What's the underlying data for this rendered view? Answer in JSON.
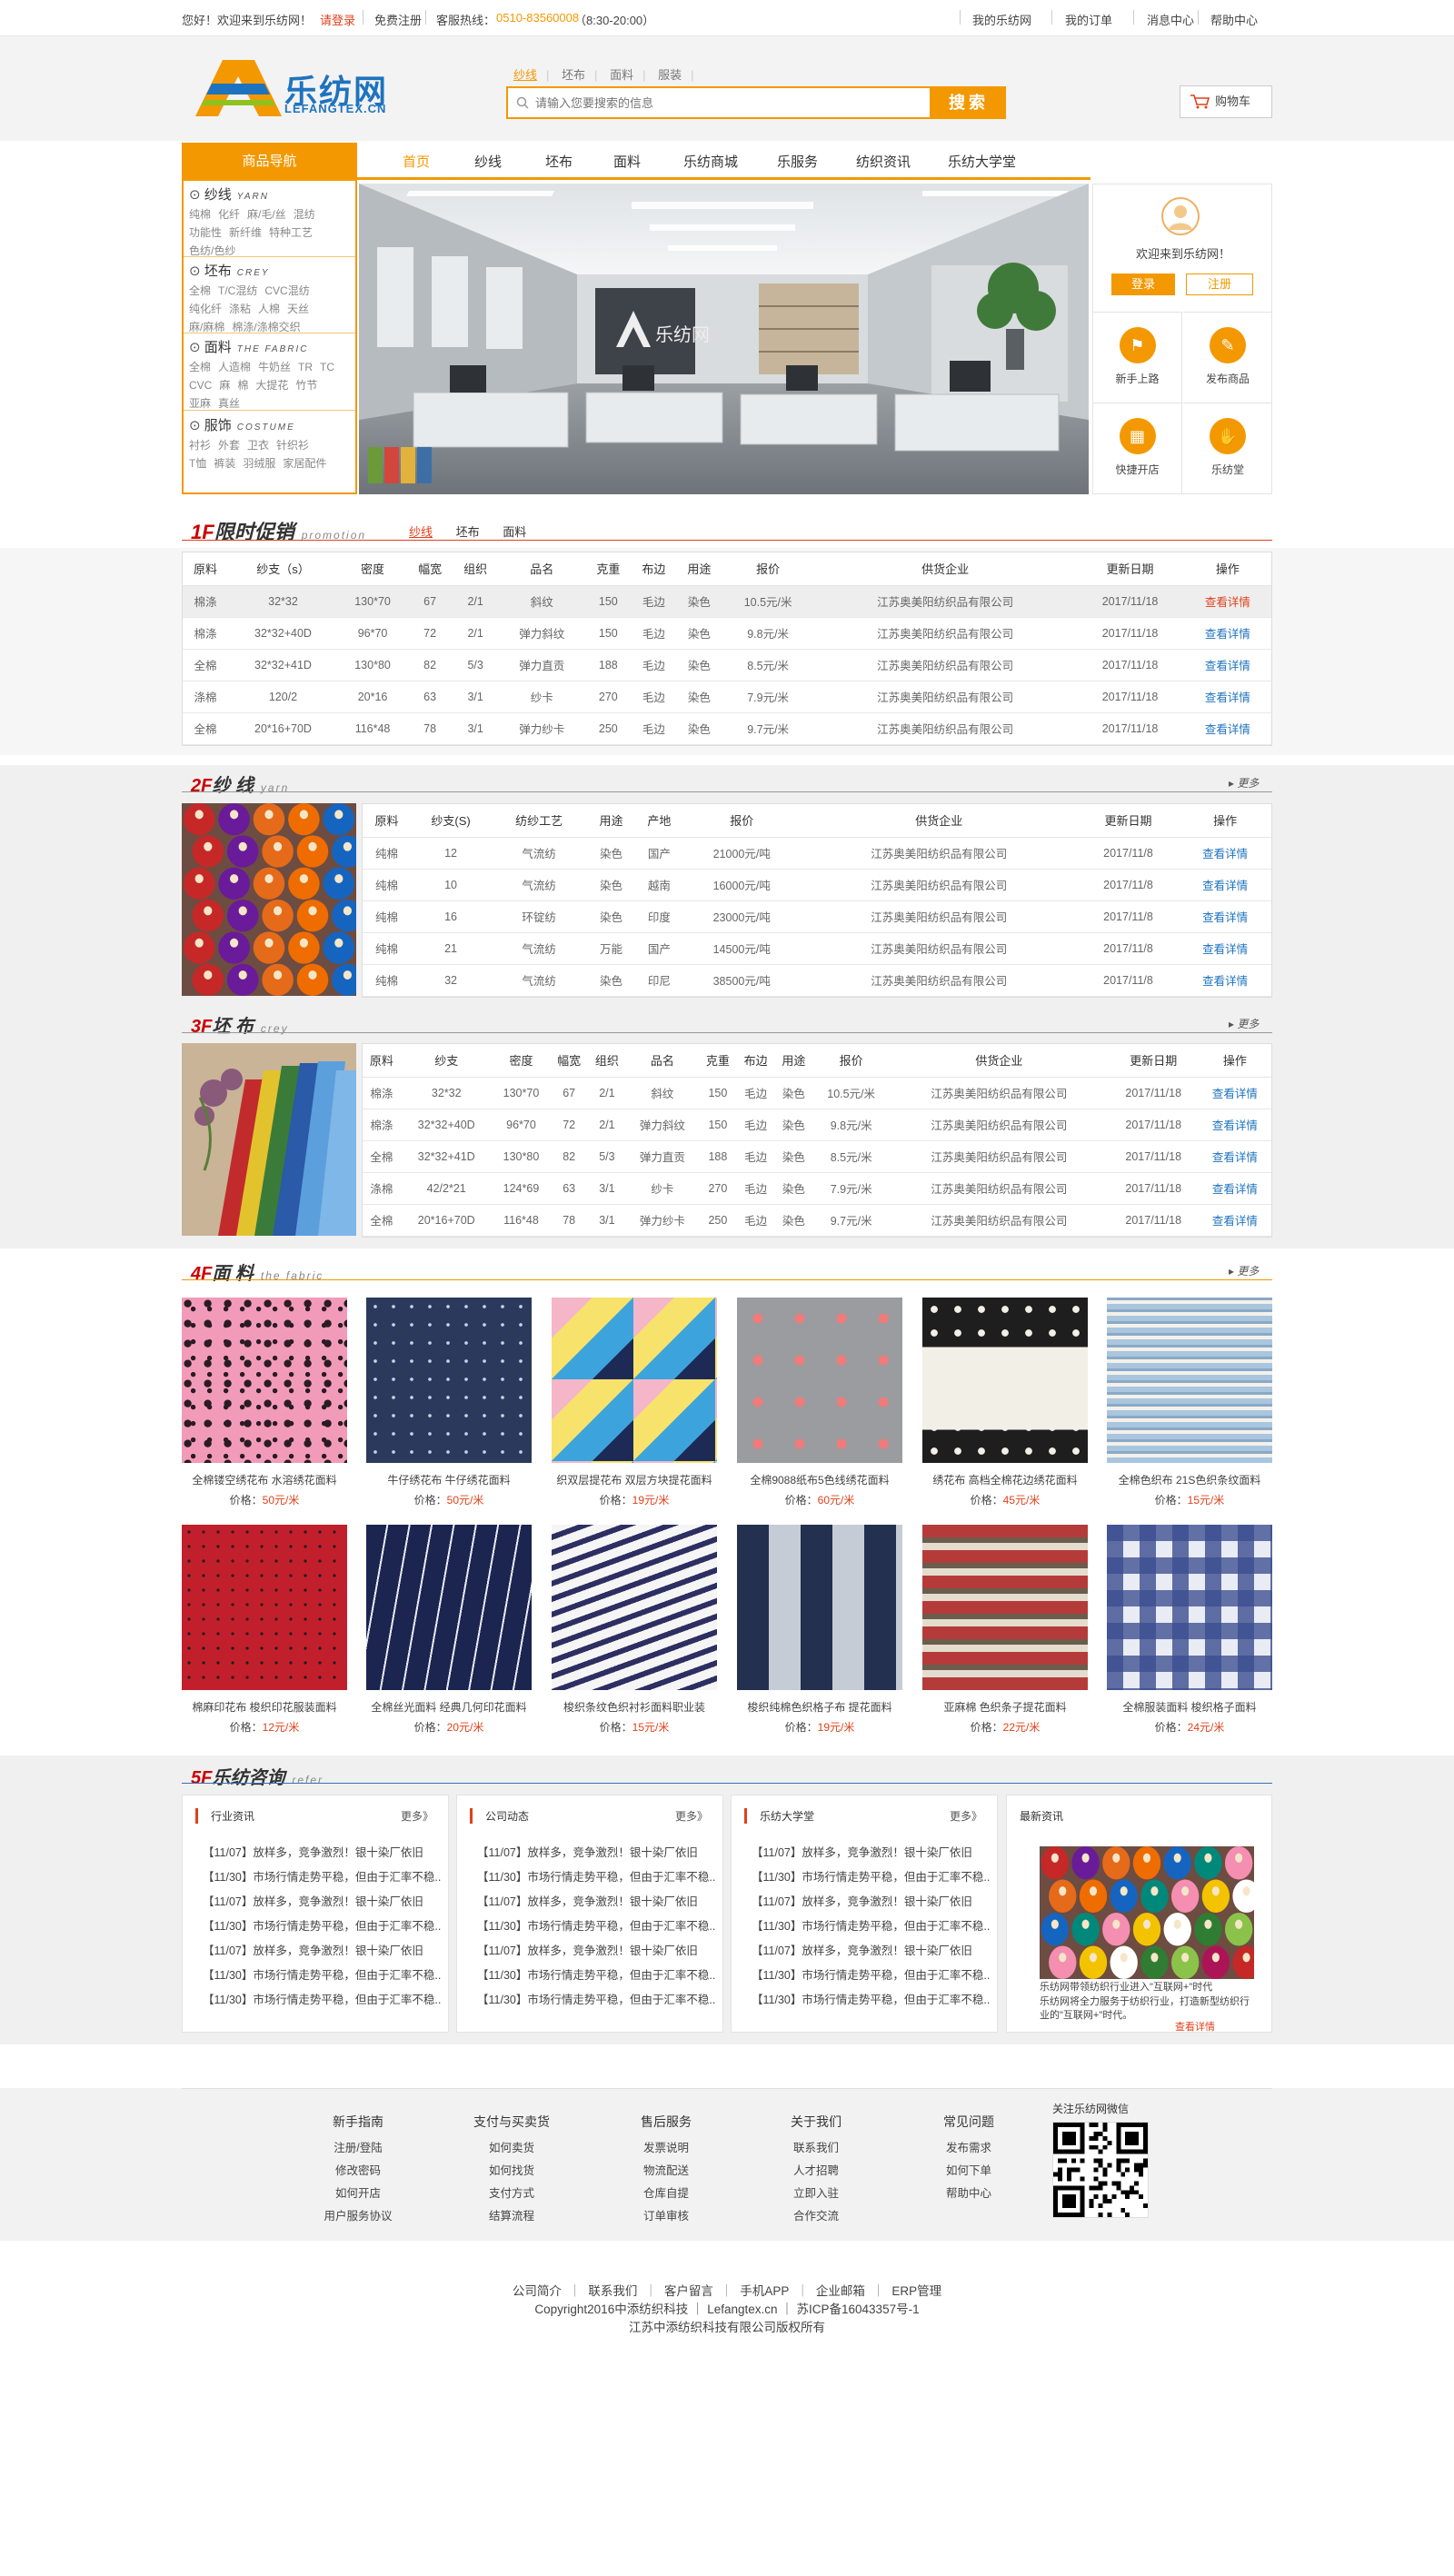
{
  "topbar": {
    "welcome": "您好！欢迎来到乐纺网！",
    "login": "请登录",
    "register": "免费注册",
    "hotline_label": "客服热线：",
    "hotline_number": "0510-83560008",
    "hotline_hours": "（8:30-20:00）",
    "links": [
      "我的乐纺网",
      "我的订单",
      "消息中心",
      "帮助中心"
    ]
  },
  "header": {
    "logo_cn": "乐纺网",
    "logo_en": "LEFANGTEX.CN",
    "search_tabs": [
      "纱线",
      "坯布",
      "面料",
      "服装"
    ],
    "search_placeholder": "请输入您要搜索的信息",
    "search_button": "搜索",
    "cart": "购物车"
  },
  "nav": {
    "category_title": "商品导航",
    "items": [
      "首页",
      "纱线",
      "坯布",
      "面料",
      "乐纺商城",
      "乐服务",
      "纺织资讯",
      "乐纺大学堂"
    ]
  },
  "categories": [
    {
      "title": "纱线",
      "en": "YARN",
      "links": [
        [
          "纯棉",
          "化纤",
          "麻/毛/丝",
          "混纺"
        ],
        [
          "功能性",
          "新纤维",
          "特种工艺"
        ],
        [
          "色纺/色纱"
        ]
      ]
    },
    {
      "title": "坯布",
      "en": "CREY",
      "links": [
        [
          "全棉",
          "T/C混纺",
          "CVC混纺"
        ],
        [
          "纯化纤",
          "涤粘",
          "人棉",
          "天丝"
        ],
        [
          "麻/麻棉",
          "棉涤/涤棉交织"
        ]
      ]
    },
    {
      "title": "面料",
      "en": "THE FABRIC",
      "links": [
        [
          "全棉",
          "人造棉",
          "牛奶丝",
          "TR",
          "TC"
        ],
        [
          "CVC",
          "麻",
          "棉",
          "大提花",
          "竹节"
        ],
        [
          "亚麻",
          "真丝"
        ]
      ]
    },
    {
      "title": "服饰",
      "en": "COSTUME",
      "links": [
        [
          "衬衫",
          "外套",
          "卫衣",
          "针织衫"
        ],
        [
          "T恤",
          "裤装",
          "羽绒服",
          "家居配件"
        ]
      ]
    }
  ],
  "banner": {
    "sign": "乐纺网"
  },
  "login_panel": {
    "welcome": "欢迎来到乐纺网！",
    "login": "登录",
    "register": "注册",
    "quick": [
      {
        "label": "新手上路",
        "icon": "flag-icon"
      },
      {
        "label": "发布商品",
        "icon": "edit-icon"
      },
      {
        "label": "快捷开店",
        "icon": "store-icon"
      },
      {
        "label": "乐纺堂",
        "icon": "handshake-icon"
      }
    ]
  },
  "floor1": {
    "num": "1F",
    "title": "限时促销",
    "en": "promotion",
    "tabs": [
      "纱线",
      "坯布",
      "面料"
    ],
    "headers": [
      "原料",
      "纱支（s）",
      "密度",
      "幅宽",
      "组织",
      "品名",
      "克重",
      "布边",
      "用途",
      "报价",
      "供货企业",
      "更新日期",
      "操作"
    ],
    "rows": [
      [
        "棉涤",
        "32*32",
        "130*70",
        "67",
        "2/1",
        "斜纹",
        "150",
        "毛边",
        "染色",
        "10.5元/米",
        "江苏奥美阳纺织品有限公司",
        "2017/11/18",
        "查看详情"
      ],
      [
        "棉涤",
        "32*32+40D",
        "96*70",
        "72",
        "2/1",
        "弹力斜纹",
        "150",
        "毛边",
        "染色",
        "9.8元/米",
        "江苏奥美阳纺织品有限公司",
        "2017/11/18",
        "查看详情"
      ],
      [
        "全棉",
        "32*32+41D",
        "130*80",
        "82",
        "5/3",
        "弹力直贡",
        "188",
        "毛边",
        "染色",
        "8.5元/米",
        "江苏奥美阳纺织品有限公司",
        "2017/11/18",
        "查看详情"
      ],
      [
        "涤棉",
        "120/2",
        "20*16",
        "63",
        "3/1",
        "纱卡",
        "270",
        "毛边",
        "染色",
        "7.9元/米",
        "江苏奥美阳纺织品有限公司",
        "2017/11/18",
        "查看详情"
      ],
      [
        "全棉",
        "20*16+70D",
        "116*48",
        "78",
        "3/1",
        "弹力纱卡",
        "250",
        "毛边",
        "染色",
        "9.7元/米",
        "江苏奥美阳纺织品有限公司",
        "2017/11/18",
        "查看详情"
      ]
    ]
  },
  "floor2": {
    "num": "2F",
    "title": "纱 线",
    "en": "yarn",
    "more": "更多",
    "headers": [
      "原料",
      "纱支(S)",
      "纺纱工艺",
      "用途",
      "产地",
      "报价",
      "供货企业",
      "更新日期",
      "操作"
    ],
    "rows": [
      [
        "纯棉",
        "12",
        "气流纺",
        "染色",
        "国产",
        "21000元/吨",
        "江苏奥美阳纺织品有限公司",
        "2017/11/8",
        "查看详情"
      ],
      [
        "纯棉",
        "10",
        "气流纺",
        "染色",
        "越南",
        "16000元/吨",
        "江苏奥美阳纺织品有限公司",
        "2017/11/8",
        "查看详情"
      ],
      [
        "纯棉",
        "16",
        "环锭纺",
        "染色",
        "印度",
        "23000元/吨",
        "江苏奥美阳纺织品有限公司",
        "2017/11/8",
        "查看详情"
      ],
      [
        "纯棉",
        "21",
        "气流纺",
        "万能",
        "国产",
        "14500元/吨",
        "江苏奥美阳纺织品有限公司",
        "2017/11/8",
        "查看详情"
      ],
      [
        "纯棉",
        "32",
        "气流纺",
        "染色",
        "印尼",
        "38500元/吨",
        "江苏奥美阳纺织品有限公司",
        "2017/11/8",
        "查看详情"
      ]
    ]
  },
  "floor3": {
    "num": "3F",
    "title": "坯 布",
    "en": "crey",
    "more": "更多",
    "headers": [
      "原料",
      "纱支",
      "密度",
      "幅宽",
      "组织",
      "品名",
      "克重",
      "布边",
      "用途",
      "报价",
      "供货企业",
      "更新日期",
      "操作"
    ],
    "rows": [
      [
        "棉涤",
        "32*32",
        "130*70",
        "67",
        "2/1",
        "斜纹",
        "150",
        "毛边",
        "染色",
        "10.5元/米",
        "江苏奥美阳纺织品有限公司",
        "2017/11/18",
        "查看详情"
      ],
      [
        "棉涤",
        "32*32+40D",
        "96*70",
        "72",
        "2/1",
        "弹力斜纹",
        "150",
        "毛边",
        "染色",
        "9.8元/米",
        "江苏奥美阳纺织品有限公司",
        "2017/11/18",
        "查看详情"
      ],
      [
        "全棉",
        "32*32+41D",
        "130*80",
        "82",
        "5/3",
        "弹力直贡",
        "188",
        "毛边",
        "染色",
        "8.5元/米",
        "江苏奥美阳纺织品有限公司",
        "2017/11/18",
        "查看详情"
      ],
      [
        "涤棉",
        "42/2*21",
        "124*69",
        "63",
        "3/1",
        "纱卡",
        "270",
        "毛边",
        "染色",
        "7.9元/米",
        "江苏奥美阳纺织品有限公司",
        "2017/11/18",
        "查看详情"
      ],
      [
        "全棉",
        "20*16+70D",
        "116*48",
        "78",
        "3/1",
        "弹力纱卡",
        "250",
        "毛边",
        "染色",
        "9.7元/米",
        "江苏奥美阳纺织品有限公司",
        "2017/11/18",
        "查看详情"
      ]
    ]
  },
  "floor4": {
    "num": "4F",
    "title": "面 料",
    "en": "the fabric",
    "more": "更多",
    "price_label": "价格：",
    "products": [
      {
        "name": "全棉镂空绣花布 水溶绣花面料",
        "price": "50元/米"
      },
      {
        "name": "牛仔绣花布 牛仔绣花面料",
        "price": "50元/米"
      },
      {
        "name": "织双层提花布 双层方块提花面料",
        "price": "19元/米"
      },
      {
        "name": "全棉9088纸布5色线绣花面料",
        "price": "60元/米"
      },
      {
        "name": "绣花布 高档全棉花边绣花面料",
        "price": "45元/米"
      },
      {
        "name": "全棉色织布 21S色织条纹面料",
        "price": "15元/米"
      },
      {
        "name": "棉麻印花布 梭织印花服装面料",
        "price": "12元/米"
      },
      {
        "name": "全棉丝光面料 经典几何印花面料",
        "price": "20元/米"
      },
      {
        "name": "梭织条纹色织衬衫面料职业装",
        "price": "15元/米"
      },
      {
        "name": "梭织纯棉色织格子布 提花面料",
        "price": "19元/米"
      },
      {
        "name": "亚麻棉 色织条子提花面料",
        "price": "22元/米"
      },
      {
        "name": "全棉服装面料 梭织格子面料",
        "price": "24元/米"
      }
    ]
  },
  "floor5": {
    "num": "5F",
    "title": "乐纺咨询",
    "en": "refer",
    "boxes": [
      {
        "title": "行业资讯",
        "more": "更多》",
        "items": [
          "【11/07】放样多，竞争激烈！银十染厂依旧",
          "【11/30】市场行情走势平稳，但由于汇率不稳..",
          "【11/07】放样多，竞争激烈！银十染厂依旧",
          "【11/30】市场行情走势平稳，但由于汇率不稳..",
          "【11/07】放样多，竞争激烈！银十染厂依旧",
          "【11/30】市场行情走势平稳，但由于汇率不稳..",
          "【11/30】市场行情走势平稳，但由于汇率不稳.."
        ]
      },
      {
        "title": "公司动态",
        "more": "更多》",
        "items": [
          "【11/07】放样多，竞争激烈！银十染厂依旧",
          "【11/30】市场行情走势平稳，但由于汇率不稳..",
          "【11/07】放样多，竞争激烈！银十染厂依旧",
          "【11/30】市场行情走势平稳，但由于汇率不稳..",
          "【11/07】放样多，竞争激烈！银十染厂依旧",
          "【11/30】市场行情走势平稳，但由于汇率不稳..",
          "【11/30】市场行情走势平稳，但由于汇率不稳.."
        ]
      },
      {
        "title": "乐纺大学堂",
        "more": "更多》",
        "items": [
          "【11/07】放样多，竞争激烈！银十染厂依旧",
          "【11/30】市场行情走势平稳，但由于汇率不稳..",
          "【11/07】放样多，竞争激烈！银十染厂依旧",
          "【11/30】市场行情走势平稳，但由于汇率不稳..",
          "【11/07】放样多，竞争激烈！银十染厂依旧",
          "【11/30】市场行情走势平稳，但由于汇率不稳..",
          "【11/30】市场行情走势平稳，但由于汇率不稳.."
        ]
      }
    ],
    "latest": {
      "title": "最新资讯",
      "headline": "乐纺网带领纺织行业进入\"互联网+\"时代",
      "body": "乐纺网将全力服务于纺织行业，打造新型纺织行业的\"互联网+\"时代。",
      "more": "查看详情"
    }
  },
  "footer": {
    "columns": [
      {
        "title": "新手指南",
        "links": [
          "注册/登陆",
          "修改密码",
          "如何开店",
          "用户服务协议"
        ]
      },
      {
        "title": "支付与买卖货",
        "links": [
          "如何卖货",
          "如何找货",
          "支付方式",
          "结算流程"
        ]
      },
      {
        "title": "售后服务",
        "links": [
          "发票说明",
          "物流配送",
          "仓库自提",
          "订单审核"
        ]
      },
      {
        "title": "关于我们",
        "links": [
          "联系我们",
          "人才招聘",
          "立即入驻",
          "合作交流"
        ]
      },
      {
        "title": "常见问题",
        "links": [
          "发布需求",
          "如何下单",
          "帮助中心"
        ]
      }
    ],
    "wechat": "关注乐纺网微信",
    "bottom_links": [
      "公司简介",
      "联系我们",
      "客户留言",
      "手机APP",
      "企业邮箱",
      "ERP管理"
    ],
    "copyright": "Copyright2016中添纺织科技 ｜ Lefangtex.cn ｜ 苏ICP备16043357号-1",
    "company": "江苏中添纺织科技有限公司版权所有"
  }
}
